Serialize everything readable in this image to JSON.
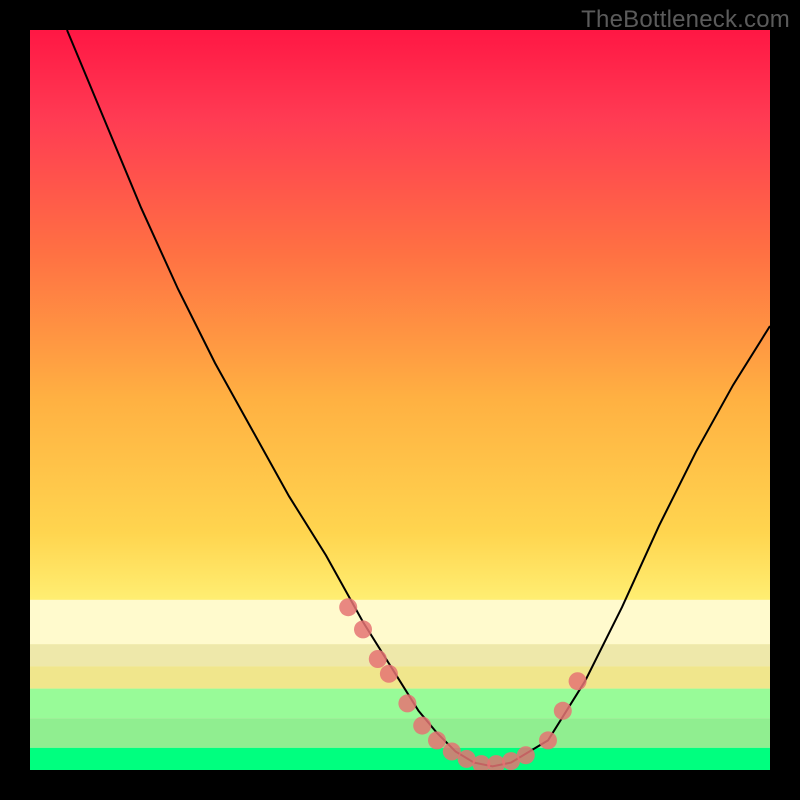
{
  "watermark": {
    "text": "TheBottleneck.com"
  },
  "chart_data": {
    "type": "line",
    "title": "",
    "xlabel": "",
    "ylabel": "",
    "xlim": [
      0,
      100
    ],
    "ylim": [
      0,
      100
    ],
    "legend": false,
    "grid": false,
    "series": [
      {
        "name": "bottleneck-curve",
        "color": "#000000",
        "x": [
          5,
          10,
          15,
          20,
          25,
          30,
          35,
          40,
          45,
          47.5,
          50,
          52.5,
          55,
          57.5,
          60,
          62.5,
          65,
          70,
          75,
          80,
          85,
          90,
          95,
          100
        ],
        "y": [
          100,
          88,
          76,
          65,
          55,
          46,
          37,
          29,
          20,
          16,
          12,
          8,
          5,
          2.5,
          1,
          0.5,
          1,
          4,
          12,
          22,
          33,
          43,
          52,
          60
        ]
      },
      {
        "name": "scatter-markers",
        "color": "#e57373",
        "type": "scatter",
        "x": [
          43,
          45,
          47,
          48.5,
          51,
          53,
          55,
          57,
          59,
          61,
          63,
          65,
          67,
          70,
          72,
          74
        ],
        "y": [
          22,
          19,
          15,
          13,
          9,
          6,
          4,
          2.5,
          1.5,
          0.8,
          0.8,
          1.2,
          2,
          4,
          8,
          12
        ]
      }
    ],
    "bands": [
      {
        "name": "lemonchiffon",
        "color": "#fffacd",
        "y0": 77,
        "y1": 83
      },
      {
        "name": "palegoldenrod",
        "color": "#eee8aa",
        "y0": 83,
        "y1": 86
      },
      {
        "name": "khaki",
        "color": "#f0e68c",
        "y0": 86,
        "y1": 89
      },
      {
        "name": "palegreen",
        "color": "#98fb98",
        "y0": 89,
        "y1": 93
      },
      {
        "name": "lightgreen",
        "color": "#90ee90",
        "y0": 93,
        "y1": 97
      },
      {
        "name": "springgreen",
        "color": "#00ff7f",
        "y0": 97,
        "y1": 100
      }
    ],
    "gradient": {
      "stops": [
        {
          "offset": 0,
          "color": "#ff1744"
        },
        {
          "offset": 12,
          "color": "#ff3b53"
        },
        {
          "offset": 30,
          "color": "#ff7043"
        },
        {
          "offset": 50,
          "color": "#ffb142"
        },
        {
          "offset": 68,
          "color": "#ffd54f"
        },
        {
          "offset": 78,
          "color": "#fff176"
        },
        {
          "offset": 80,
          "color": "#fffacd"
        }
      ]
    }
  }
}
